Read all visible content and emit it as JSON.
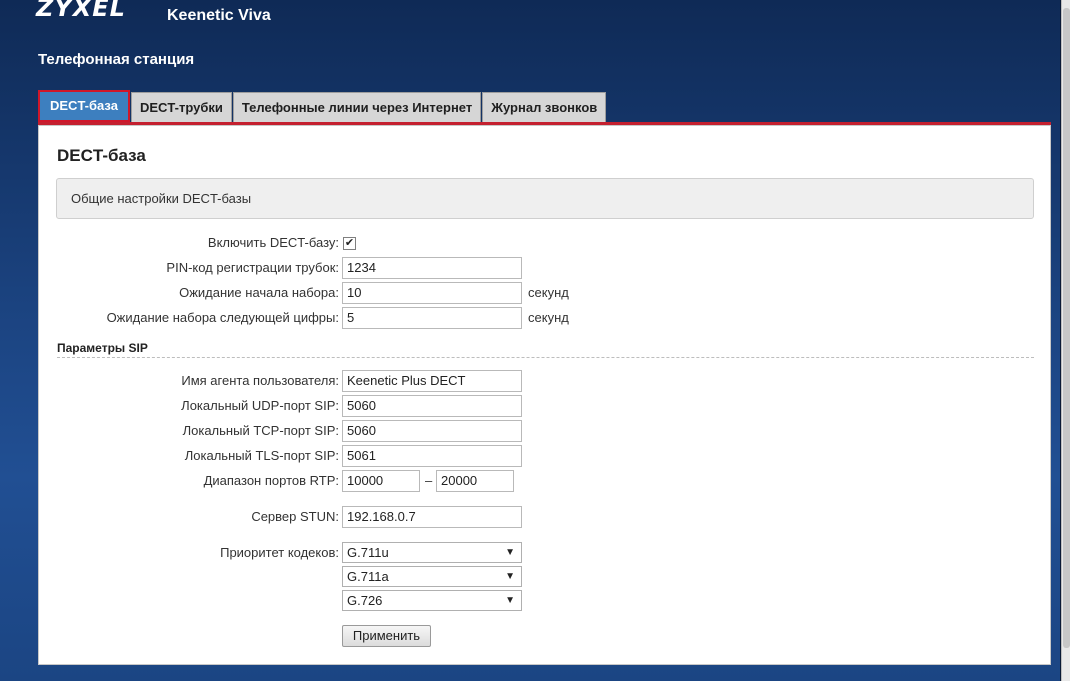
{
  "header": {
    "brand": "ZYXEL",
    "model": "Keenetic Viva",
    "page_title": "Телефонная станция"
  },
  "tabs": [
    {
      "label": "DECT-база",
      "active": true
    },
    {
      "label": "DECT-трубки",
      "active": false
    },
    {
      "label": "Телефонные линии через Интернет",
      "active": false
    },
    {
      "label": "Журнал звонков",
      "active": false
    }
  ],
  "panel": {
    "title": "DECT-база",
    "info": "Общие настройки DECT-базы"
  },
  "general": {
    "enable_label": "Включить DECT-базу:",
    "enable_checked": true,
    "pin_label": "PIN-код регистрации трубок:",
    "pin_value": "1234",
    "dial_wait_label": "Ожидание начала набора:",
    "dial_wait_value": "10",
    "dial_wait_unit": "секунд",
    "next_digit_label": "Ожидание набора следующей цифры:",
    "next_digit_value": "5",
    "next_digit_unit": "секунд"
  },
  "sip": {
    "section_title": "Параметры SIP",
    "user_agent_label": "Имя агента пользователя:",
    "user_agent_value": "Keenetic Plus DECT",
    "udp_label": "Локальный UDP-порт SIP:",
    "udp_value": "5060",
    "tcp_label": "Локальный TCP-порт SIP:",
    "tcp_value": "5060",
    "tls_label": "Локальный TLS-порт SIP:",
    "tls_value": "5061",
    "rtp_label": "Диапазон портов RTP:",
    "rtp_from": "10000",
    "rtp_separator": "–",
    "rtp_to": "20000",
    "stun_label": "Сервер STUN:",
    "stun_value": "192.168.0.7",
    "codec_label": "Приоритет кодеков:",
    "codecs": [
      "G.711u",
      "G.711a",
      "G.726"
    ]
  },
  "apply_label": "Применить",
  "colors": {
    "accent_blue": "#3d7fbf",
    "active_border": "#d0172a",
    "background_blue": "#1b4380"
  }
}
